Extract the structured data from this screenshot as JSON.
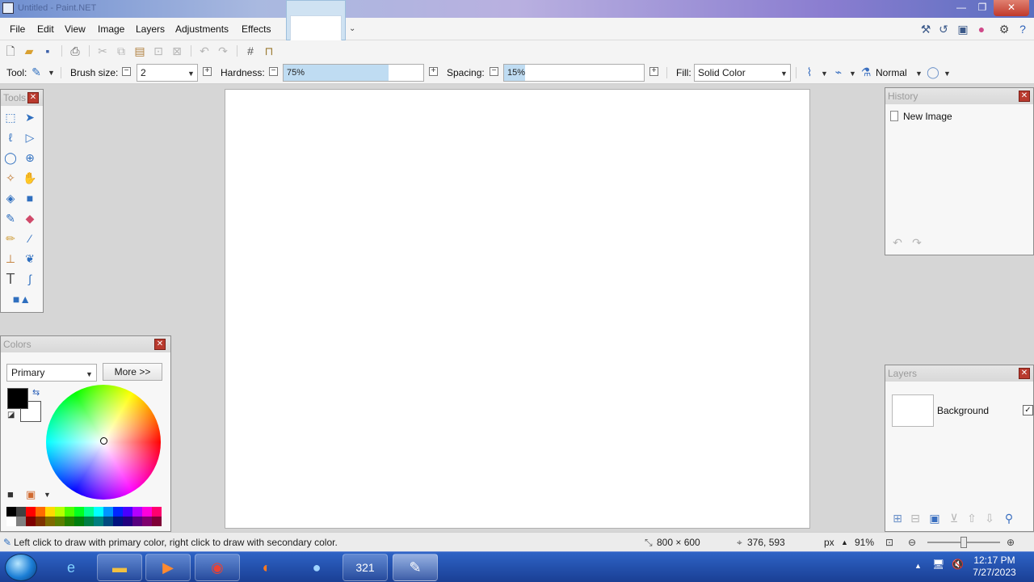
{
  "window": {
    "title": "Untitled - Paint.NET",
    "minimize": "—",
    "maximize": "❐",
    "close": "✕"
  },
  "menu": {
    "items": [
      "File",
      "Edit",
      "View",
      "Image",
      "Layers",
      "Adjustments",
      "Effects"
    ]
  },
  "toolbar": {
    "tool_label": "Tool:",
    "brush_size_label": "Brush size:",
    "brush_size_value": "2",
    "hardness_label": "Hardness:",
    "hardness_value": "75%",
    "hardness_fraction": 0.75,
    "spacing_label": "Spacing:",
    "spacing_value": "15%",
    "spacing_fraction": 0.15,
    "fill_label": "Fill:",
    "fill_value": "Solid Color",
    "blend_mode": "Normal"
  },
  "tools_panel": {
    "title": "Tools"
  },
  "history_panel": {
    "title": "History",
    "items": [
      "New Image"
    ]
  },
  "colors_panel": {
    "title": "Colors",
    "select_value": "Primary",
    "more_button": "More >>",
    "primary_color": "#000000",
    "secondary_color": "#ffffff"
  },
  "layers_panel": {
    "title": "Layers",
    "layers": [
      {
        "name": "Background",
        "visible": true
      }
    ]
  },
  "status": {
    "hint": "Left click to draw with primary color, right click to draw with secondary color.",
    "image_size": "800 × 600",
    "cursor_position": "376, 593",
    "unit": "px",
    "zoom": "91%"
  },
  "taskbar": {
    "time": "12:17 PM",
    "date": "7/27/2023",
    "apps": [
      "internet-explorer",
      "file-explorer",
      "media-player",
      "chrome",
      "firefox",
      "thunderbird",
      "video-editor",
      "paint-net"
    ]
  }
}
